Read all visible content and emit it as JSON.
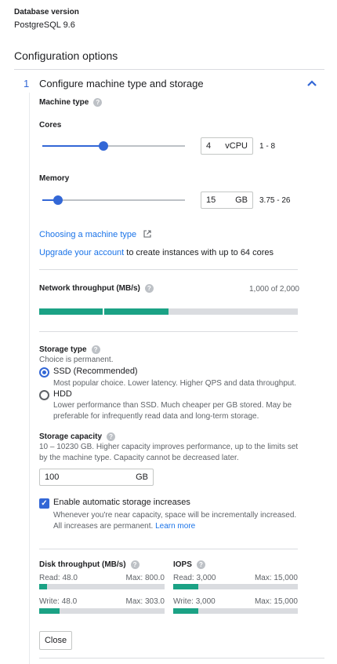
{
  "database": {
    "label": "Database version",
    "value": "PostgreSQL 9.6"
  },
  "section": {
    "title": "Configuration options"
  },
  "step": {
    "number": "1",
    "title": "Configure machine type and storage",
    "collapse_icon": "chevron-up-icon"
  },
  "machine": {
    "label": "Machine type",
    "cores": {
      "label": "Cores",
      "value": "4",
      "unit": "vCPU",
      "range": "1 - 8",
      "level": 0.43
    },
    "memory": {
      "label": "Memory",
      "value": "15",
      "unit": "GB",
      "range": "3.75 - 26",
      "level": 0.11
    },
    "choosing_link": "Choosing a machine type",
    "upgrade_link": "Upgrade your account",
    "upgrade_text": " to create instances with up to 64 cores"
  },
  "network": {
    "label": "Network throughput (MB/s)",
    "value_text": "1,000 of 2,000",
    "fraction": 0.5
  },
  "storage_type": {
    "label": "Storage type",
    "note": "Choice is permanent.",
    "options": [
      {
        "label": "SSD (Recommended)",
        "desc": "Most popular choice. Lower latency. Higher QPS and data throughput.",
        "selected": true
      },
      {
        "label": "HDD",
        "desc": "Lower performance than SSD. Much cheaper per GB stored. May be preferable for infrequently read data and long-term storage.",
        "selected": false
      }
    ]
  },
  "storage_capacity": {
    "label": "Storage capacity",
    "desc": "10 – 10230 GB. Higher capacity improves performance, up to the limits set by the machine type. Capacity cannot be decreased later.",
    "value": "100",
    "unit": "GB"
  },
  "auto_increase": {
    "label": "Enable automatic storage increases",
    "desc": "Whenever you're near capacity, space will be incrementally increased. All increases are permanent. ",
    "learn_more": "Learn more",
    "checked": true
  },
  "disk_throughput": {
    "label": "Disk throughput (MB/s)",
    "read": {
      "label": "Read: 48.0",
      "max": "Max: 800.0",
      "fraction": 0.06
    },
    "write": {
      "label": "Write: 48.0",
      "max": "Max: 303.0",
      "fraction": 0.16
    }
  },
  "iops": {
    "label": "IOPS",
    "read": {
      "label": "Read: 3,000",
      "max": "Max: 15,000",
      "fraction": 0.2
    },
    "write": {
      "label": "Write: 3,000",
      "max": "Max: 15,000",
      "fraction": 0.2
    }
  },
  "close_button": "Close",
  "help_glyph": "?",
  "external_icon": "external-link-icon",
  "colors": {
    "accent": "#3367d6",
    "bar_fill": "#1ba285",
    "link": "#1a73e8"
  }
}
